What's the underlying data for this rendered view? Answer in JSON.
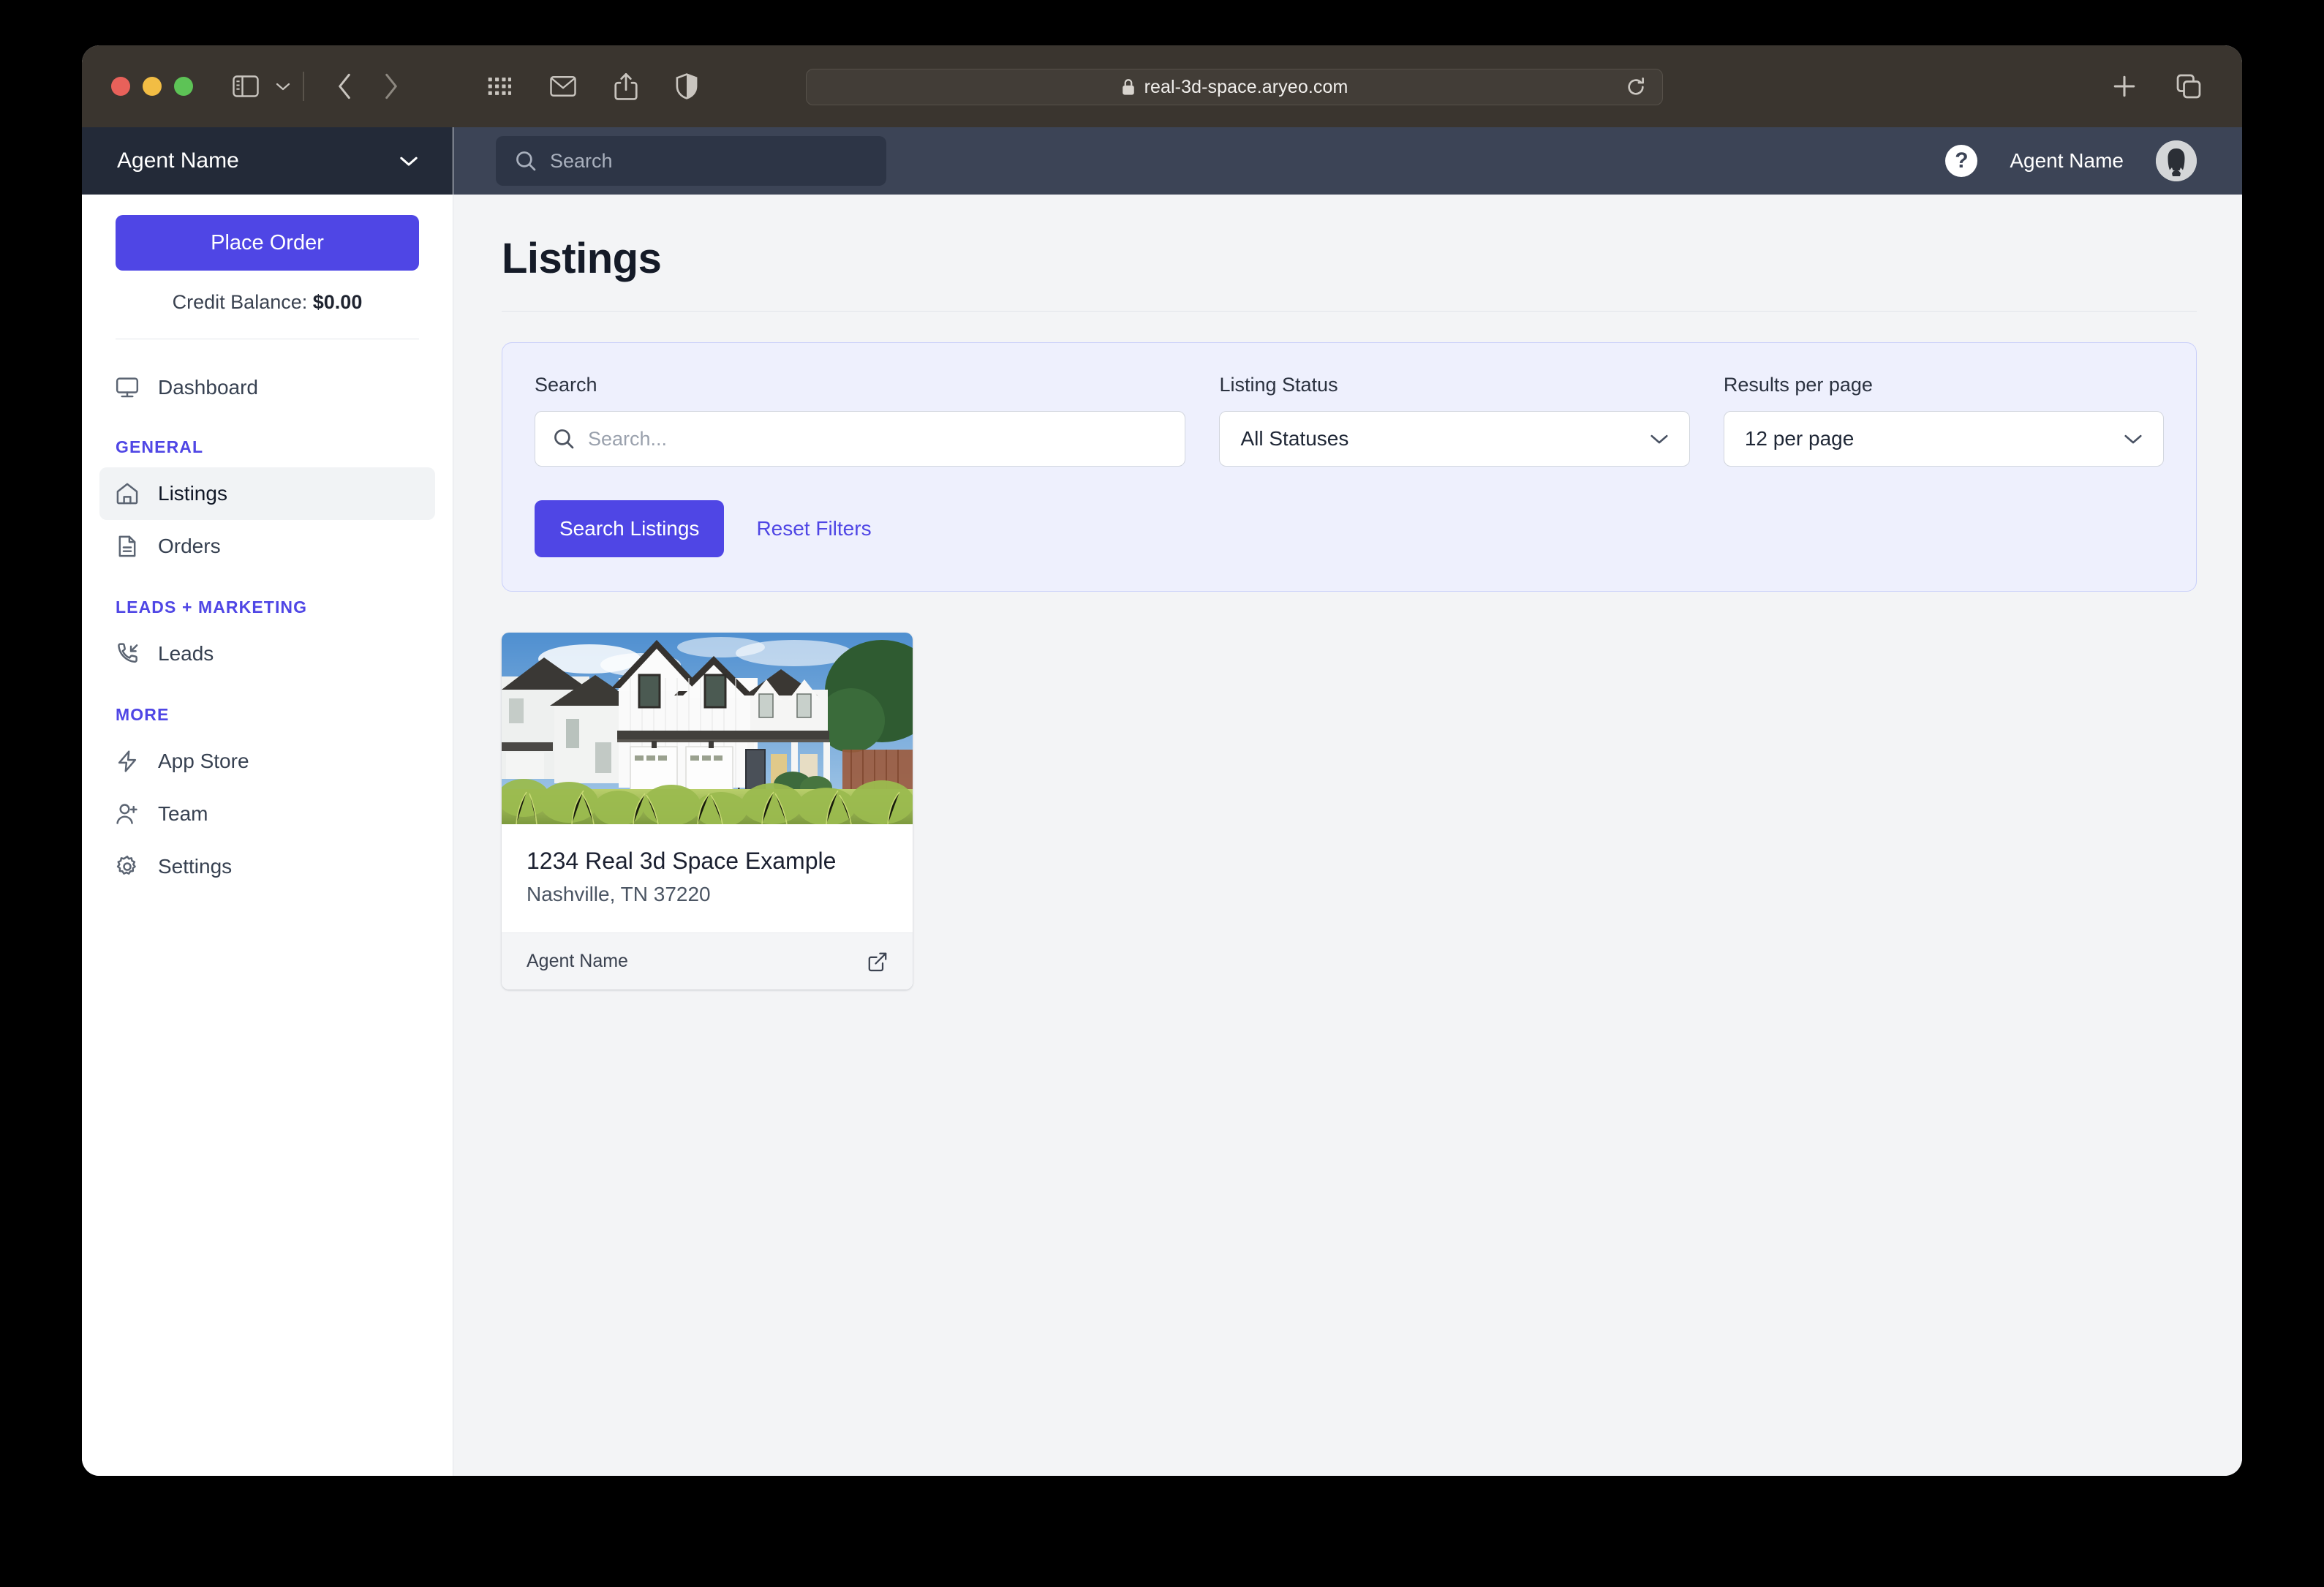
{
  "browser": {
    "url": "real-3d-space.aryeo.com",
    "lock_icon": "lock-icon",
    "reload_icon": "reload-icon",
    "new_tab_icon": "plus-icon",
    "tabs_icon": "tab-overview-icon",
    "sidebar_icon": "sidebar-toggle-icon",
    "back_icon": "chevron-left-icon",
    "forward_icon": "chevron-right-icon",
    "apps_icon": "grid-apps-icon",
    "mail_icon": "mail-icon",
    "share_icon": "share-icon",
    "shield_icon": "privacy-shield-icon"
  },
  "sidebar": {
    "org_name": "Agent Name",
    "org_chevron_icon": "chevron-down-icon",
    "place_order_label": "Place Order",
    "credit_label": "Credit Balance:",
    "credit_value": "$0.00",
    "dashboard": {
      "label": "Dashboard",
      "icon": "monitor-icon"
    },
    "sections": [
      {
        "title": "GENERAL",
        "items": [
          {
            "label": "Listings",
            "icon": "home-icon",
            "active": true
          },
          {
            "label": "Orders",
            "icon": "document-icon",
            "active": false
          }
        ]
      },
      {
        "title": "LEADS + MARKETING",
        "items": [
          {
            "label": "Leads",
            "icon": "phone-incoming-icon",
            "active": false
          }
        ]
      },
      {
        "title": "MORE",
        "items": [
          {
            "label": "App Store",
            "icon": "lightning-icon",
            "active": false
          },
          {
            "label": "Team",
            "icon": "user-plus-icon",
            "active": false
          },
          {
            "label": "Settings",
            "icon": "gear-icon",
            "active": false
          }
        ]
      }
    ]
  },
  "topbar": {
    "search_placeholder": "Search",
    "search_icon": "search-icon",
    "help_glyph": "?",
    "user_name": "Agent Name",
    "avatar_icon": "user-avatar"
  },
  "page": {
    "title": "Listings"
  },
  "filters": {
    "search_label": "Search",
    "search_placeholder": "Search...",
    "search_icon": "search-icon",
    "status_label": "Listing Status",
    "status_value": "All Statuses",
    "status_options": [
      "All Statuses"
    ],
    "perpage_label": "Results per page",
    "perpage_value": "12 per page",
    "perpage_options": [
      "12 per page"
    ],
    "chevron_icon": "chevron-down-icon",
    "search_button_label": "Search Listings",
    "reset_button_label": "Reset Filters"
  },
  "listings": [
    {
      "title": "1234 Real 3d Space Example",
      "subtitle": "Nashville, TN 37220",
      "agent": "Agent Name",
      "external_icon": "external-link-icon",
      "photo_alt": "white-modern-farmhouse-exterior"
    }
  ],
  "colors": {
    "accent": "#4f46e5",
    "sidebar_header": "#232a38",
    "topbar": "#3c4456",
    "filter_panel_bg": "#eef0fd",
    "filter_panel_border": "#c9cffa",
    "page_bg": "#f3f4f6",
    "chrome_bg": "#3a352f"
  }
}
